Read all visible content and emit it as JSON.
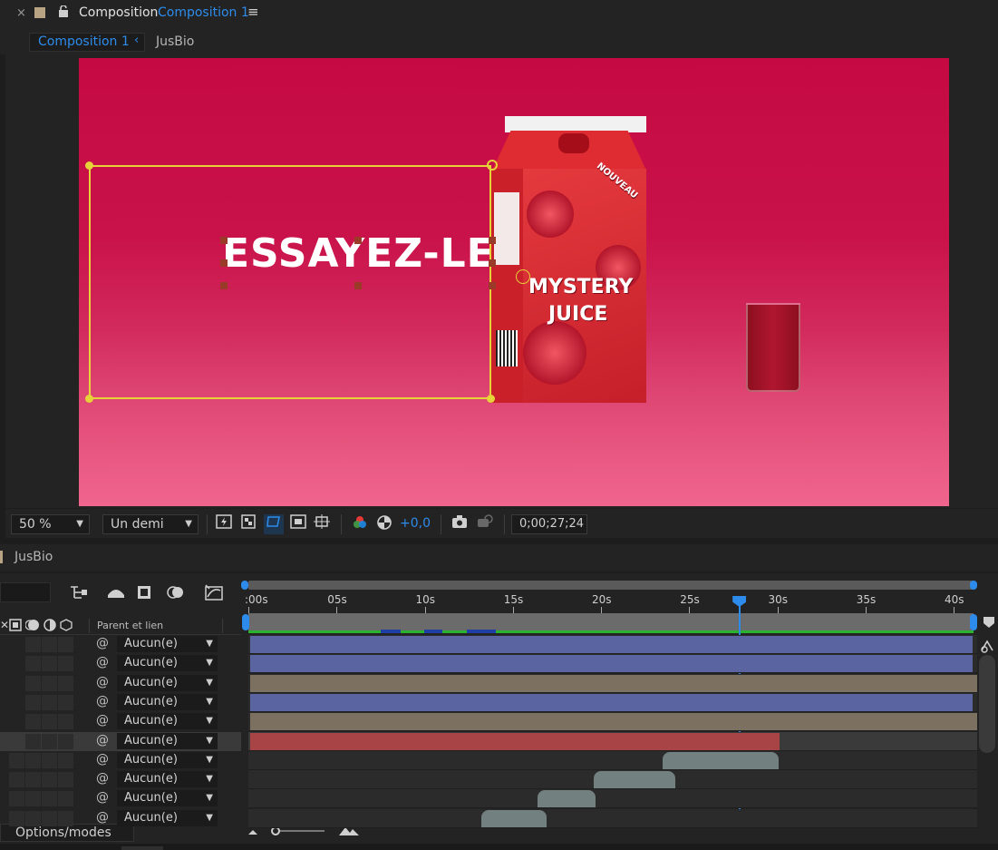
{
  "header": {
    "close_glyph": "×",
    "title": "Composition",
    "comp_name": "Composition 1",
    "menu_glyph": "≡"
  },
  "breadcrumb": {
    "active": "Composition 1",
    "separator": "‹",
    "next": "JusBio"
  },
  "canvas": {
    "headline": "ESSAYEZ-LE",
    "carton_brand_line1": "MYSTERY",
    "carton_brand_line2": "JUICE",
    "carton_badge": "NOUVEAU"
  },
  "viewer_toolbar": {
    "zoom": "50 %",
    "resolution": "Un demi",
    "exposure": "+0,0",
    "timecode": "0;00;27;24"
  },
  "timeline": {
    "tab_name": "JusBio",
    "parent_column_label": "Parent et lien",
    "ruler_ticks": [
      ":00s",
      "05s",
      "10s",
      "15s",
      "20s",
      "25s",
      "30s",
      "35s",
      "40s"
    ],
    "layers": [
      {
        "parent": "Aucun(e)",
        "bar_color": "#5a64a0",
        "start": 0,
        "end": 41
      },
      {
        "parent": "Aucun(e)",
        "bar_color": "#5a64a0",
        "start": 0,
        "end": 41
      },
      {
        "parent": "Aucun(e)",
        "bar_color": "#7c7060",
        "start": 0,
        "end": 41.5
      },
      {
        "parent": "Aucun(e)",
        "bar_color": "#5a64a0",
        "start": 0,
        "end": 41
      },
      {
        "parent": "Aucun(e)",
        "bar_color": "#7c7060",
        "start": 0,
        "end": 41.5
      },
      {
        "parent": "Aucun(e)",
        "bar_color": "#a84446",
        "start": 0,
        "end": 30
      },
      {
        "parent": "Aucun(e)",
        "bar_color": "#738080",
        "start": 23.4,
        "end": 30
      },
      {
        "parent": "Aucun(e)",
        "bar_color": "#738080",
        "start": 19.5,
        "end": 24.1
      },
      {
        "parent": "Aucun(e)",
        "bar_color": "#738080",
        "start": 16.3,
        "end": 19.6
      },
      {
        "parent": "Aucun(e)",
        "bar_color": "#738080",
        "start": 13.1,
        "end": 16.8
      }
    ],
    "playhead_seconds": 27.8
  },
  "bottom": {
    "options_label": "Options/modes"
  },
  "colors": {
    "accent": "#2d8ceb",
    "selection": "#e6d33a",
    "panel": "#232323"
  }
}
